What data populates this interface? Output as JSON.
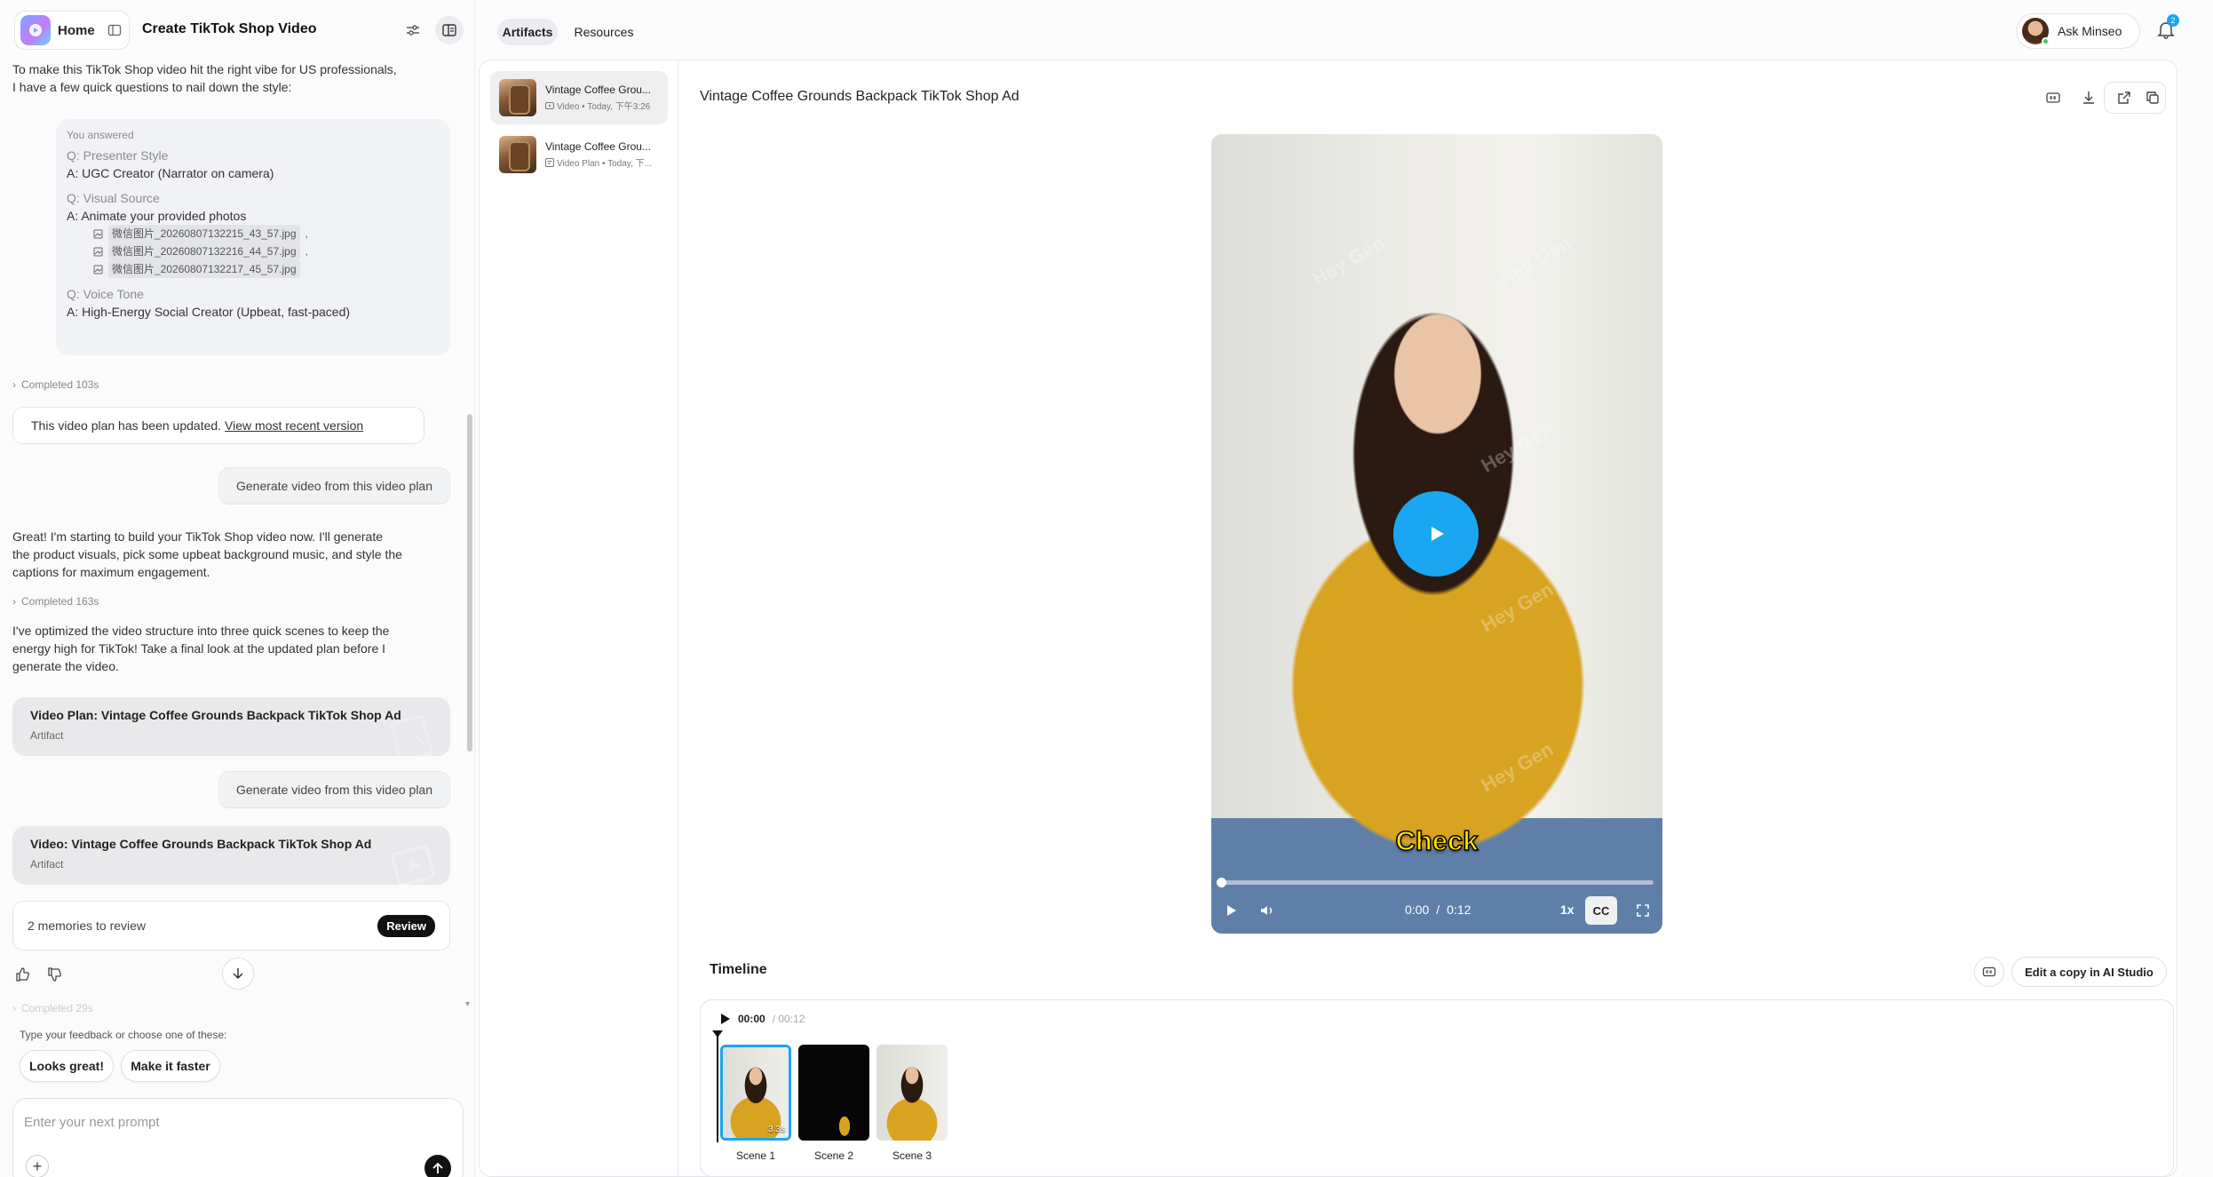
{
  "left": {
    "home_label": "Home",
    "project_title": "Create TikTok Shop Video",
    "intro": "To make this TikTok Shop video hit the right vibe for US professionals, I have a few quick questions to nail down the style:",
    "answers": {
      "header": "You answered",
      "q1": "Q: Presenter Style",
      "a1": "A: UGC Creator (Narrator on camera)",
      "q2": "Q: Visual Source",
      "a2": "A: Animate your provided photos",
      "files": [
        "微信图片_20260807132215_43_57.jpg",
        "微信图片_20260807132216_44_57.jpg",
        "微信图片_20260807132217_45_57.jpg"
      ],
      "file_sep": ",",
      "q3": "Q: Voice Tone",
      "a3": "A: High-Energy Social Creator (Upbeat, fast-paced)"
    },
    "completed_1": "Completed 103s",
    "plan_updated_text": "This video plan has been updated.",
    "plan_updated_link": "View most recent version",
    "user_msg": "Generate video from this video plan",
    "reply_1": "Great! I'm starting to build your TikTok Shop video now. I'll generate the product visuals, pick some upbeat background music, and style the captions for maximum engagement.",
    "completed_2": "Completed 163s",
    "reply_2": "I've optimized the video structure into three quick scenes to keep the energy high for TikTok! Take a final look at the updated plan before I generate the video.",
    "artifact_1_title": "Video Plan: Vintage Coffee Grounds Backpack TikTok Shop Ad",
    "artifact_1_sub": "Artifact",
    "artifact_2_title": "Video: Vintage Coffee Grounds Backpack TikTok Shop Ad",
    "artifact_2_sub": "Artifact",
    "memories_text": "2 memories to review",
    "review_label": "Review",
    "completed_3": "Completed 29s",
    "feedback_hint": "Type your feedback or choose one of these:",
    "chip_1": "Looks great!",
    "chip_2": "Make it faster",
    "prompt_placeholder": "Enter your next prompt"
  },
  "tabs": {
    "artifacts": "Artifacts",
    "resources": "Resources"
  },
  "user": {
    "ask_label": "Ask Minseo",
    "notif_count": "2"
  },
  "artifact_list": [
    {
      "title": "Vintage Coffee Grou...",
      "meta": "Video • Today, 下午3:26"
    },
    {
      "title": "Vintage Coffee Grou...",
      "meta": "Video Plan • Today, 下..."
    }
  ],
  "artifact_header": "Vintage Coffee Grounds Backpack TikTok Shop Ad",
  "video": {
    "watermark": "Hey Gen",
    "caption": "Check",
    "current_time": "0:00",
    "time_sep": "/",
    "duration": "0:12",
    "progress": 0.0,
    "speed": "1x",
    "cc": "CC"
  },
  "timeline": {
    "title": "Timeline",
    "edit_label": "Edit a copy in AI Studio",
    "current": "00:00",
    "total": "/ 00:12",
    "scenes": [
      {
        "label": "Scene 1",
        "duration": "3.3s"
      },
      {
        "label": "Scene 2"
      },
      {
        "label": "Scene 3"
      }
    ]
  },
  "colors": {
    "accent": "#1aa6f0",
    "caption": "#ffe600",
    "sweater": "#d8a320"
  }
}
